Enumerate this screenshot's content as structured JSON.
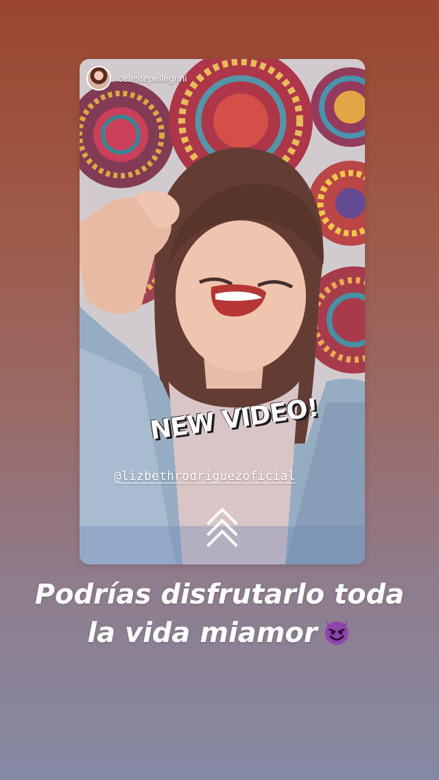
{
  "story": {
    "author": "celestepellegrini",
    "sticker_text": "NEW VIDEO!",
    "mention": "@lizbethrodriguezoficial",
    "caption_line1": "Podrías disfrutarlo toda",
    "caption_line2": "la vida miamor",
    "caption_emoji": "smiling-devil-emoji",
    "swipe_icon": "swipe-up-chevrons-icon"
  },
  "colors": {
    "background_top": "#9a4630",
    "background_bottom": "#858aa3",
    "text": "#ffffff",
    "emoji": "#8e44ad"
  }
}
